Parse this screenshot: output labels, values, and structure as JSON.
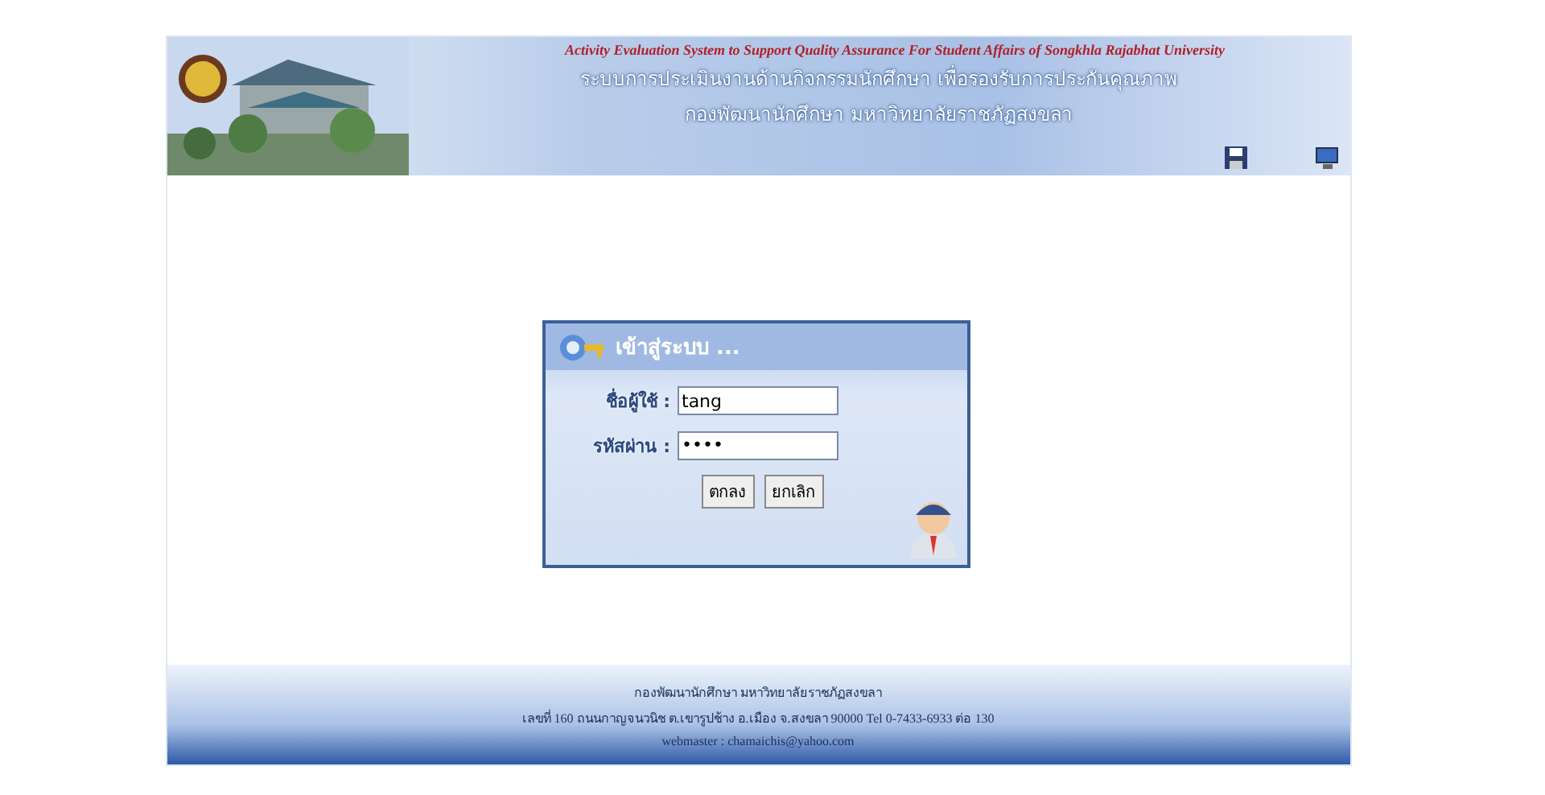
{
  "header": {
    "title_en": "Activity Evaluation System to Support Quality Assurance For Student Affairs of Songkhla Rajabhat University",
    "title_th": "ระบบการประเมินงานด้านกิจกรรมนักศึกษา  เพื่อรองรับการประกันคุณภาพ",
    "subtitle": "กองพัฒนานักศึกษา  มหาวิทยาลัยราชภัฏสงขลา"
  },
  "login": {
    "title": "เข้าสู่ระบบ ...",
    "fields": [
      {
        "label": "ชื่อผู้ใช้ :",
        "value": "tang",
        "kind": "text"
      },
      {
        "label": "รหัสผ่าน :",
        "value": "••••",
        "kind": "password"
      }
    ],
    "buttons": [
      "ตกลง",
      "ยกเลิก"
    ]
  },
  "footer": {
    "lines": [
      "กองพัฒนานักศึกษา มหาวิทยาลัยราชภัฏสงขลา",
      "เลขที่ 160 ถนนกาญจนวนิช ต.เขารูปช้าง อ.เมือง จ.สงขลา 90000 Tel 0-7433-6933 ต่อ 130",
      "webmaster : chamaichis@yahoo.com"
    ]
  }
}
